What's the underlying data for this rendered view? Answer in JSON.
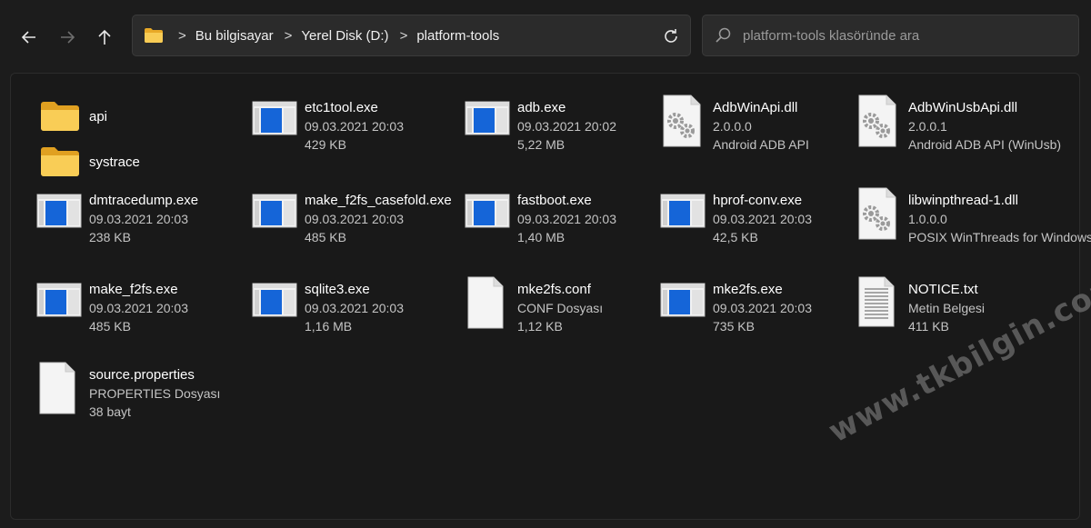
{
  "nav": {
    "back_icon": "arrow-left-icon",
    "forward_icon": "arrow-right-icon",
    "up_icon": "arrow-up-icon"
  },
  "address": {
    "crumbs": [
      "Bu bilgisayar",
      "Yerel Disk (D:)",
      "platform-tools"
    ],
    "separator": ">",
    "refresh_icon": "refresh-icon"
  },
  "search": {
    "placeholder": "platform-tools klasöründe ara"
  },
  "items": [
    {
      "name": "api",
      "type": "folder"
    },
    {
      "name": "systrace",
      "type": "folder"
    },
    {
      "name": "etc1tool.exe",
      "date": "09.03.2021 20:03",
      "size": "429 KB",
      "type": "exe"
    },
    {
      "name": "adb.exe",
      "date": "09.03.2021 20:02",
      "size": "5,22 MB",
      "type": "exe"
    },
    {
      "name": "AdbWinApi.dll",
      "version": "2.0.0.0",
      "desc": "Android ADB API",
      "type": "dll"
    },
    {
      "name": "AdbWinUsbApi.dll",
      "version": "2.0.0.1",
      "desc": "Android ADB API (WinUsb)",
      "type": "dll"
    },
    {
      "name": "dmtracedump.exe",
      "date": "09.03.2021 20:03",
      "size": "238 KB",
      "type": "exe"
    },
    {
      "name": "make_f2fs_casefold.exe",
      "date": "09.03.2021 20:03",
      "size": "485 KB",
      "type": "exe"
    },
    {
      "name": "fastboot.exe",
      "date": "09.03.2021 20:03",
      "size": "1,40 MB",
      "type": "exe"
    },
    {
      "name": "hprof-conv.exe",
      "date": "09.03.2021 20:03",
      "size": "42,5 KB",
      "type": "exe"
    },
    {
      "name": "libwinpthread-1.dll",
      "version": "1.0.0.0",
      "desc": "POSIX WinThreads for Windows",
      "type": "dll"
    },
    {
      "name": "make_f2fs.exe",
      "date": "09.03.2021 20:03",
      "size": "485 KB",
      "type": "exe"
    },
    {
      "name": "sqlite3.exe",
      "date": "09.03.2021 20:03",
      "size": "1,16 MB",
      "type": "exe"
    },
    {
      "name": "mke2fs.conf",
      "kind": "CONF Dosyası",
      "size": "1,12 KB",
      "type": "file"
    },
    {
      "name": "mke2fs.exe",
      "date": "09.03.2021 20:03",
      "size": "735 KB",
      "type": "exe"
    },
    {
      "name": "NOTICE.txt",
      "kind": "Metin Belgesi",
      "size": "411 KB",
      "type": "txt"
    },
    {
      "name": "source.properties",
      "kind": "PROPERTIES Dosyası",
      "size": "38 bayt",
      "type": "file"
    }
  ],
  "watermark": "www.tkbilgin.com"
}
